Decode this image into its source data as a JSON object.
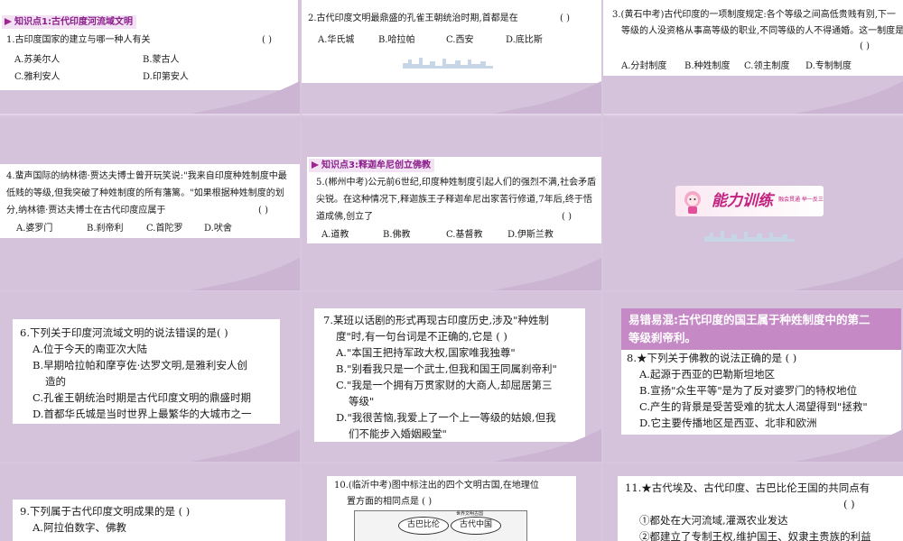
{
  "slide1": {
    "kp": "知识点1:古代印度河流域文明",
    "q1": "1.古印度国家的建立与哪一种人有关",
    "paren": "(      )",
    "opts": [
      "A.苏美尔人",
      "B.蒙古人",
      "C.雅利安人",
      "D.印第安人"
    ]
  },
  "slide2": {
    "q2": "2.古代印度文明最鼎盛的孔雀王朝统治时期,首都是在",
    "paren": "(      )",
    "opts": [
      "A.华氏城",
      "B.哈拉帕",
      "C.西安",
      "D.底比斯"
    ]
  },
  "slide3": {
    "lines": [
      "3.(黄石中考)古代印度的一项制度规定:各个等级之间高低贵贱有别,下一",
      "等级的人没资格从事高等级的职业,不同等级的人不得通婚。这一制度是"
    ],
    "paren": "(      )",
    "opts": [
      "A.分封制度",
      "B.种姓制度",
      "C.领主制度",
      "D.专制制度"
    ]
  },
  "slide4": {
    "lines": [
      "4.蜚声国际的纳林德·贾达夫博士曾开玩笑说:\"我来自印度种姓制度中最",
      "低贱的等级,但我突破了种姓制度的所有藩篱。\"如果根据种姓制度的划",
      "分,纳林德·贾达夫博士在古代印度应属于"
    ],
    "paren": "(      )",
    "opts": [
      "A.婆罗门",
      "B.刹帝利",
      "C.首陀罗",
      "D.吠舍"
    ]
  },
  "slide5": {
    "kp": "知识点3:释迦牟尼创立佛教",
    "lines": [
      "5.(郴州中考)公元前6世纪,印度种姓制度引起人们的强烈不满,社会矛盾",
      "尖锐。在这种情况下,释迦族王子释迦牟尼出家苦行修道,7年后,终于悟",
      "道成佛,创立了"
    ],
    "paren": "(      )",
    "opts": [
      "A.道教",
      "B.佛教",
      "C.基督教",
      "D.伊斯兰教"
    ]
  },
  "slide6": {
    "logo": "能力训练",
    "logo_sub": "融会贯通 举一反三"
  },
  "slide7": {
    "lines": [
      "6.下列关于印度河流域文明的说法错误的是(      )",
      "A.位于今天的南亚次大陆",
      "B.早期哈拉帕和摩亨佐·达罗文明,是雅利安人创",
      "造的",
      "C.孔雀王朝统治时期是古代印度文明的鼎盛时期",
      "D.首都华氏城是当时世界上最繁华的大城市之一"
    ]
  },
  "slide8": {
    "lines": [
      "7.某班以话剧的形式再现古印度历史,涉及\"种姓制",
      "度\"时,有一句台词是不正确的,它是        (      )",
      "A.\"本国王把持军政大权,国家唯我独尊\"",
      "B.\"别看我只是一个武士,但我和国王同属刹帝利\"",
      "C.\"我是一个拥有万贯家财的大商人,却屈居第三",
      "等级\"",
      "D.\"我很苦恼,我爱上了一个上一等级的姑娘,但我",
      "们不能步入婚姻殿堂\""
    ]
  },
  "slide9": {
    "banner": [
      "易错易混:古代印度的国王属于种姓制度中的第二",
      "等级刹帝利。"
    ],
    "lines": [
      "8.★下列关于佛教的说法正确的是              (      )",
      "A.起源于西亚的巴勒斯坦地区",
      "B.宣扬\"众生平等\"是为了反对婆罗门的特权地位",
      "C.产生的背景是受苦受难的犹太人渴望得到\"拯救\"",
      "D.它主要传播地区是西亚、北非和欧洲"
    ]
  },
  "slide10": {
    "lines": [
      "9.下列属于古代印度文明成果的是      (      )",
      "A.阿拉伯数字、佛教"
    ]
  },
  "slide11": {
    "lines": [
      "10.(临沂中考)图中标注出的四个文明古国,在地理位",
      "置方面的相同点是                    (      )"
    ],
    "map_labels": [
      "古巴比伦",
      "古代中国",
      "世界文明古国"
    ]
  },
  "slide12": {
    "lines": [
      "11.★古代埃及、古代印度、古巴比伦王国的共同点有",
      "(      )",
      "①都处在大河流域,灌溉农业发达",
      "②都建立了专制王权,维护国王、奴隶主贵族的利益"
    ]
  }
}
